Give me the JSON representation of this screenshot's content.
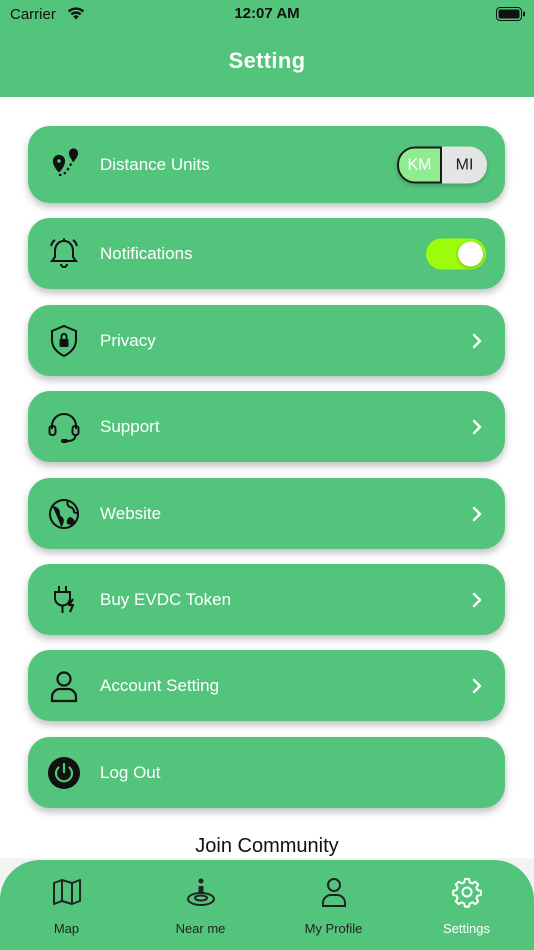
{
  "status_bar": {
    "carrier": "Carrier",
    "time": "12:07 AM"
  },
  "header": {
    "title": "Setting"
  },
  "settings": {
    "distance": {
      "label": "Distance Units",
      "icon": "map-pin-route-icon",
      "options": [
        "KM",
        "MI"
      ],
      "selected": "KM"
    },
    "notifications": {
      "label": "Notifications",
      "icon": "bell-icon",
      "enabled": true
    },
    "privacy": {
      "label": "Privacy",
      "icon": "shield-lock-icon"
    },
    "support": {
      "label": "Support",
      "icon": "headset-icon"
    },
    "website": {
      "label": "Website",
      "icon": "globe-icon"
    },
    "token": {
      "label": "Buy EVDC Token",
      "icon": "plug-charge-icon"
    },
    "account": {
      "label": "Account Setting",
      "icon": "user-icon"
    },
    "logout": {
      "label": "Log Out",
      "icon": "power-icon"
    }
  },
  "community": {
    "label": "Join Community"
  },
  "tabs": [
    {
      "label": "Map",
      "icon": "map-icon"
    },
    {
      "label": "Near me",
      "icon": "location-person-icon"
    },
    {
      "label": "My Profile",
      "icon": "profile-icon"
    },
    {
      "label": "Settings",
      "icon": "gear-icon",
      "active": true
    }
  ],
  "colors": {
    "primary": "#53c47c",
    "toggle_on": "#9cfc0a",
    "km_selected": "#90ec90"
  }
}
